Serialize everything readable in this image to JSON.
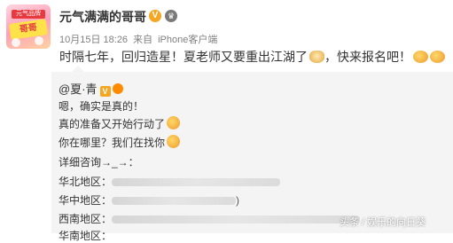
{
  "header": {
    "avatar_badge_top": "元气品牌",
    "avatar_badge_mid": "哥哥",
    "username": "元气满满的哥哥",
    "verified_glyph": "V",
    "timestamp": "10月15日 18:26",
    "source_prefix": "来自",
    "source": "iPhone客户端"
  },
  "post": {
    "text_part1": "时隔七年，回归造星！夏老师又要重出江湖了",
    "text_part2": "，快来报名吧！",
    "icons": [
      "dog-emoji-icon",
      "clap-emoji-icon",
      "clap-emoji-icon"
    ]
  },
  "repost": {
    "mention": "@夏·青",
    "mention_badge": "V",
    "lines": {
      "l1": "嗯，确实是真的！",
      "l2": "真的准备又开始行动了",
      "l3": "你在哪里？我们在找你",
      "l4": "详细咨询→_→：",
      "l5_label": "华北地区：",
      "l6_label": "华中地区：",
      "l6_tail": ")",
      "l7_label": "西南地区：",
      "l8_label": "华南地区："
    }
  },
  "watermark": "头条 / 娱乐的向日葵",
  "colors": {
    "text": "#333333",
    "meta": "#808080",
    "repost_bg": "#f4f4f4",
    "verified": "#f5a623"
  }
}
